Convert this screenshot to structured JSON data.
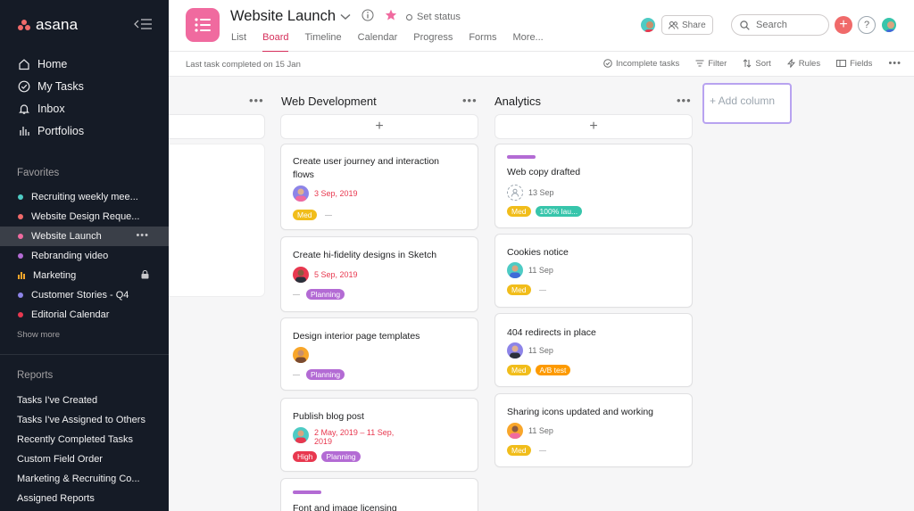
{
  "sidebar": {
    "logo": "asana",
    "nav": [
      {
        "label": "Home",
        "icon": "home-icon"
      },
      {
        "label": "My Tasks",
        "icon": "check-circle-icon"
      },
      {
        "label": "Inbox",
        "icon": "bell-icon"
      },
      {
        "label": "Portfolios",
        "icon": "bar-chart-icon"
      }
    ],
    "favorites_title": "Favorites",
    "favorites": [
      {
        "label": "Recruiting weekly mee...",
        "color": "#4ecbc4"
      },
      {
        "label": "Website Design Reque...",
        "color": "#f06a6a"
      },
      {
        "label": "Website Launch",
        "color": "#f06a9f"
      },
      {
        "label": "Rebranding video",
        "color": "#b36bd4"
      },
      {
        "label": "Marketing",
        "color": "#f8a62a"
      },
      {
        "label": "Customer Stories - Q4",
        "color": "#8d84e8"
      },
      {
        "label": "Editorial Calendar",
        "color": "#e8384f"
      }
    ],
    "show_more": "Show more",
    "reports_title": "Reports",
    "reports": [
      "Tasks I've Created",
      "Tasks I've Assigned to Others",
      "Recently Completed Tasks",
      "Custom Field Order",
      "Marketing & Recruiting Co...",
      "Assigned Reports"
    ]
  },
  "header": {
    "title": "Website Launch",
    "set_status": "Set status",
    "tabs": [
      "List",
      "Board",
      "Timeline",
      "Calendar",
      "Progress",
      "Forms",
      "More..."
    ],
    "active_tab": "Board",
    "share": "Share",
    "search_placeholder": "Search",
    "help": "?"
  },
  "toolbar": {
    "last_task": "Last task completed on 15 Jan",
    "incomplete": "Incomplete tasks",
    "filter": "Filter",
    "sort": "Sort",
    "rules": "Rules",
    "fields": "Fields"
  },
  "board": {
    "add_column": "+ Add column",
    "columns": [
      {
        "title": "Web Development",
        "cards": [
          {
            "title_lines": [
              "Create user journey and interaction",
              "flows"
            ],
            "due": "3 Sep, 2019",
            "tags": [
              {
                "label": "Med",
                "color": "#f1bd1b"
              }
            ]
          },
          {
            "title_lines": [
              "Create hi-fidelity designs in Sketch"
            ],
            "due": "5 Sep, 2019",
            "tags": [
              {
                "label": "Planning",
                "color": "#b36bd4"
              }
            ]
          },
          {
            "title_lines": [
              "Design interior page templates"
            ],
            "due": "",
            "tags": [
              {
                "label": "Planning",
                "color": "#b36bd4"
              }
            ]
          },
          {
            "title_lines": [
              "Publish blog post"
            ],
            "due_lines": [
              "2 May, 2019 – 11 Sep,",
              "2019"
            ],
            "tags": [
              {
                "label": "High",
                "color": "#e8384f"
              },
              {
                "label": "Planning",
                "color": "#b36bd4"
              }
            ]
          },
          {
            "title_lines": [
              "Font and image licensing"
            ]
          }
        ]
      },
      {
        "title": "Analytics",
        "cards": [
          {
            "title_lines": [
              "Web copy drafted"
            ],
            "due": "13 Sep",
            "tags": [
              {
                "label": "Med",
                "color": "#f1bd1b"
              },
              {
                "label": "100% lau...",
                "color": "#37c5ab"
              }
            ]
          },
          {
            "title_lines": [
              "Cookies notice"
            ],
            "due": "11 Sep",
            "tags": [
              {
                "label": "Med",
                "color": "#f1bd1b"
              }
            ]
          },
          {
            "title_lines": [
              "404 redirects in place"
            ],
            "due": "11 Sep",
            "tags": [
              {
                "label": "Med",
                "color": "#f1bd1b"
              },
              {
                "label": "A/B test",
                "color": "#fd9a00"
              }
            ]
          },
          {
            "title_lines": [
              "Sharing icons updated and working"
            ],
            "due": "11 Sep",
            "tags": [
              {
                "label": "Med",
                "color": "#f1bd1b"
              }
            ]
          }
        ]
      }
    ]
  }
}
